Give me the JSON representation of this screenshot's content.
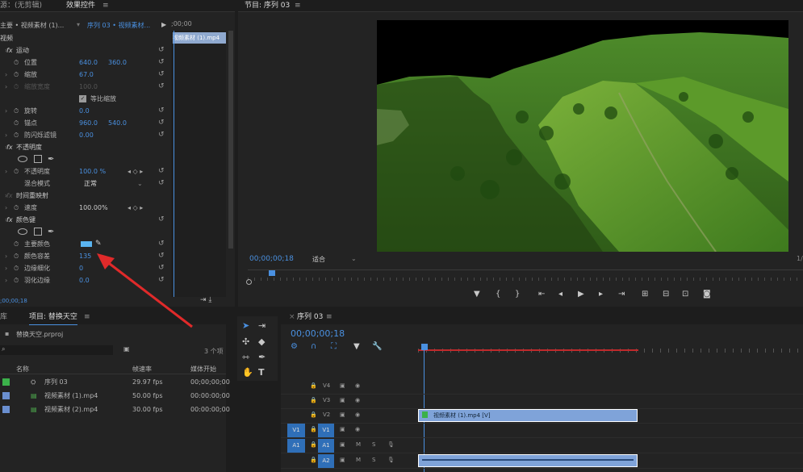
{
  "effect_controls": {
    "tab_source": "源：(无剪辑)",
    "tab_effects": "效果控件",
    "tab_menu": "≡",
    "master_clip": "主要 • 视频素材 (1)...",
    "sequence_clip": "序列 03 • 视频素材...",
    "timeline_start": ";00;00",
    "clip_label": "视频素材 (1).mp4",
    "section_video": "视频",
    "motion": {
      "name": "运动"
    },
    "position": {
      "label": "位置",
      "x": "640.0",
      "y": "360.0"
    },
    "scale": {
      "label": "缩放",
      "value": "67.0"
    },
    "scale_width": {
      "label": "缩放宽度",
      "value": "100.0"
    },
    "uniform_scale": {
      "label": "等比缩放"
    },
    "rotation": {
      "label": "旋转",
      "value": "0.0"
    },
    "anchor": {
      "label": "锚点",
      "x": "960.0",
      "y": "540.0"
    },
    "anti_flicker": {
      "label": "防闪烁滤镜",
      "value": "0.00"
    },
    "opacity": {
      "name": "不透明度"
    },
    "opacity_value": {
      "label": "不透明度",
      "value": "100.0 %"
    },
    "blend_mode": {
      "label": "混合模式",
      "value": "正常"
    },
    "time_remap": {
      "name": "时间重映射"
    },
    "speed": {
      "label": "速度",
      "value": "100.00%"
    },
    "color_key": {
      "name": "颜色键"
    },
    "key_color": {
      "label": "主要颜色"
    },
    "color_tolerance": {
      "label": "颜色容差",
      "value": "135"
    },
    "edge_thin": {
      "label": "边缘细化",
      "value": "0"
    },
    "feather": {
      "label": "羽化边缘",
      "value": "0.0"
    },
    "footer_time": ";00;00;18",
    "fx": "fx",
    "key_color_hex": "#5ab4f0"
  },
  "program": {
    "title": "节目: 序列 03",
    "menu": "≡",
    "timecode": "00;00;00;18",
    "fit": "适合",
    "right_fraction": "1/"
  },
  "project": {
    "tab_left": "库",
    "tab_project": "项目: 替换天空",
    "menu": "≡",
    "file": "替换天空.prproj",
    "count": "3 个项",
    "col_name": "名称",
    "col_rate": "帧速率",
    "col_start": "媒体开始",
    "items": [
      {
        "name": "序列 03",
        "rate": "29.97 fps",
        "start": "00;00;00;00",
        "color": "#3bb14a"
      },
      {
        "name": "视频素材 (1).mp4",
        "rate": "50.00 fps",
        "start": "00:00:00;00",
        "color": "#6a8fd0"
      },
      {
        "name": "视频素材 (2).mp4",
        "rate": "30.00 fps",
        "start": "00:00:00;00",
        "color": "#6a8fd0"
      }
    ]
  },
  "timeline": {
    "tab": "序列 03",
    "menu": "≡",
    "timecode": "00;00;00;18",
    "tracks": {
      "v4": "V4",
      "v3": "V3",
      "v2": "V2",
      "v1": "V1",
      "a1": "A1",
      "a2": "A2"
    },
    "clip_v2": "视频素材 (1).mp4 [V]",
    "m": "M",
    "s": "S"
  },
  "colors": {
    "accent": "#4a90e0",
    "work_area": "#c0292b",
    "clip": "#7fa3d9"
  }
}
